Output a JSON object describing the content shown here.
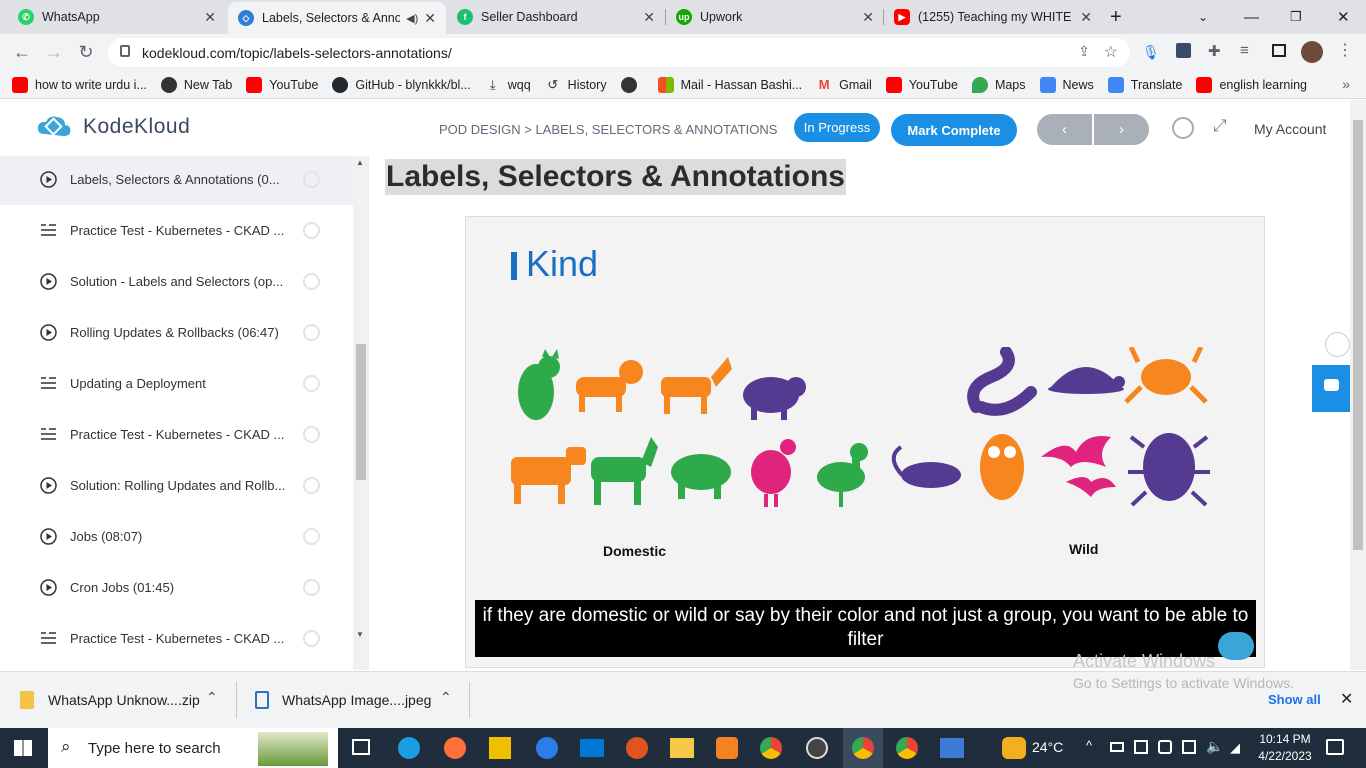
{
  "browser": {
    "tabs": [
      {
        "title": "WhatsApp",
        "icon": "whatsapp-icon",
        "color": "#25d366"
      },
      {
        "title": "Labels, Selectors & Anno",
        "icon": "kodekloud-icon",
        "color": "#2e7fd6"
      },
      {
        "title": "Seller Dashboard",
        "icon": "fiverr-icon",
        "color": "#1dbf73"
      },
      {
        "title": "Upwork",
        "icon": "upwork-icon",
        "color": "#14a800"
      },
      {
        "title": "(1255) Teaching my WHITE fr",
        "icon": "youtube-icon",
        "color": "#ff0000"
      }
    ],
    "url": "kodekloud.com/topic/labels-selectors-annotations/",
    "bookmarks": [
      "how to write urdu i...",
      "New Tab",
      "YouTube",
      "GitHub - blynkkk/bl...",
      "wqq",
      "History",
      "",
      "Mail - Hassan Bashi...",
      "Gmail",
      "YouTube",
      "Maps",
      "News",
      "Translate",
      "english learning"
    ]
  },
  "header": {
    "logo": "KodeKloud",
    "breadcrumb": "POD DESIGN > LABELS, SELECTORS & ANNOTATIONS",
    "status": "In Progress",
    "mark_complete": "Mark Complete",
    "prev": "‹",
    "next": "›",
    "account": "My Account",
    "colors": {
      "blue": "#1a8fe3",
      "gray": "#a9b0b8"
    }
  },
  "sidebar": {
    "items": [
      {
        "label": "Labels, Selectors & Annotations (0...",
        "type": "video"
      },
      {
        "label": "Practice Test - Kubernetes - CKAD ...",
        "type": "test"
      },
      {
        "label": "Solution - Labels and Selectors (op...",
        "type": "video"
      },
      {
        "label": "Rolling Updates & Rollbacks (06:47)",
        "type": "video"
      },
      {
        "label": "Updating a Deployment",
        "type": "test"
      },
      {
        "label": "Practice Test - Kubernetes - CKAD ...",
        "type": "test"
      },
      {
        "label": "Solution: Rolling Updates and Rollb...",
        "type": "video"
      },
      {
        "label": "Jobs (08:07)",
        "type": "video"
      },
      {
        "label": "Cron Jobs (01:45)",
        "type": "video"
      },
      {
        "label": "Practice Test - Kubernetes - CKAD ...",
        "type": "test"
      }
    ]
  },
  "content": {
    "title": "Labels, Selectors & Annotations",
    "slide": {
      "heading": "Kind",
      "left_label": "Domestic",
      "right_label": "Wild"
    },
    "caption": "if they are domestic or wild or say by their color and not just a group, you want to be able to filter",
    "watermark_title": "Activate Windows",
    "watermark_sub": "Go to Settings to activate Windows."
  },
  "downloads": {
    "items": [
      "WhatsApp Unknow....zip",
      "WhatsApp Image....jpeg"
    ],
    "show_all": "Show all"
  },
  "taskbar": {
    "search_placeholder": "Type here to search",
    "weather": "24°C",
    "time": "10:14 PM",
    "date": "4/22/2023"
  }
}
